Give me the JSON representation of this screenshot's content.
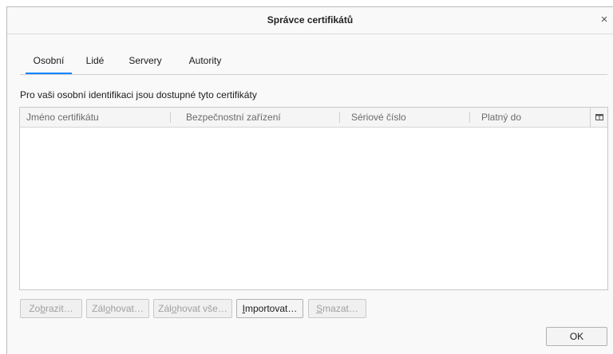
{
  "window": {
    "title": "Správce certifikátů",
    "close_symbol": "×"
  },
  "tabs": [
    {
      "label": "Osobní",
      "selected": true
    },
    {
      "label": "Lidé",
      "selected": false
    },
    {
      "label": "Servery",
      "selected": false
    },
    {
      "label": "Autority",
      "selected": false
    }
  ],
  "description": "Pro vaši osobní identifikaci jsou dostupné tyto certifikáty",
  "table": {
    "columns": [
      "Jméno certifikátu",
      "Bezpečnostní zařízení",
      "Sériové číslo",
      "Platný do"
    ],
    "rows": [],
    "column_picker_icon": "column-picker-icon"
  },
  "buttons": {
    "view": {
      "pre": "Zo",
      "key": "b",
      "post": "razit…",
      "enabled": false
    },
    "backup": {
      "pre": "Zál",
      "key": "o",
      "post": "hovat…",
      "enabled": false
    },
    "backup_all": {
      "pre": "Zál",
      "key": "o",
      "post": "hovat vše…",
      "enabled": false
    },
    "import": {
      "pre": "",
      "key": "I",
      "post": "mportovat…",
      "enabled": true
    },
    "delete": {
      "pre": "",
      "key": "S",
      "post": "mazat…",
      "enabled": false
    },
    "ok": "OK"
  },
  "colors": {
    "accent": "#0a84ff",
    "dialog_bg": "#f9f9fa"
  }
}
